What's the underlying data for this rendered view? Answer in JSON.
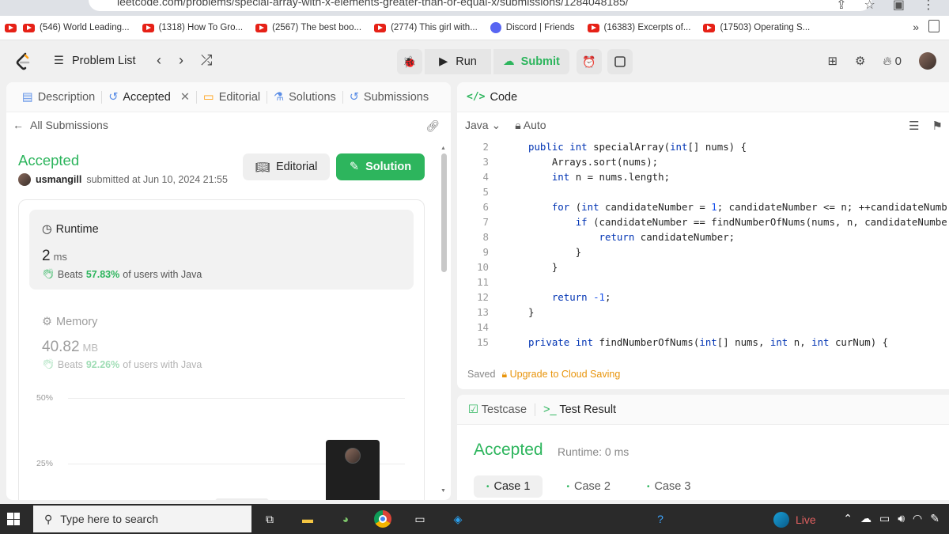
{
  "browser": {
    "url": "leetcode.com/problems/special-array-with-x-elements-greater-than-or-equal-x/submissions/1284048185/",
    "bookmarks": [
      {
        "icon": "youtube-icon",
        "label": "(546) World Leading..."
      },
      {
        "icon": "youtube-icon",
        "label": "(1318) How To Gro..."
      },
      {
        "icon": "youtube-icon",
        "label": "(2567) The best boo..."
      },
      {
        "icon": "youtube-icon",
        "label": "(2774) This girl with..."
      },
      {
        "icon": "discord-icon",
        "label": "Discord | Friends"
      },
      {
        "icon": "youtube-icon",
        "label": "(16383) Excerpts of..."
      },
      {
        "icon": "youtube-icon",
        "label": "(17503) Operating S..."
      }
    ],
    "more_label": "»"
  },
  "nav": {
    "problem_list": "Problem List",
    "run": "Run",
    "submit": "Submit",
    "streak": "0"
  },
  "left": {
    "tabs": [
      "Description",
      "Accepted",
      "Editorial",
      "Solutions",
      "Submissions"
    ],
    "all_submissions": "All Submissions",
    "status": "Accepted",
    "username": "usmangill",
    "submitted_text": "submitted at Jun 10, 2024 21:55",
    "editorial_btn": "Editorial",
    "solution_btn": "Solution",
    "runtime": {
      "label": "Runtime",
      "value": "2",
      "unit": "ms",
      "beats_prefix": "Beats",
      "beats_pct": "57.83%",
      "beats_suffix": "of users with Java"
    },
    "memory": {
      "label": "Memory",
      "value": "40.82",
      "unit": "MB",
      "beats_prefix": "Beats",
      "beats_pct": "92.26%",
      "beats_suffix": "of users with Java"
    }
  },
  "chart_data": {
    "type": "bar",
    "ylim": [
      0,
      60
    ],
    "y_ticks": [
      "50%",
      "25%"
    ],
    "bars": [
      {
        "value": 5,
        "highlight": false
      },
      {
        "value": 12,
        "highlight": false
      },
      {
        "value": 34,
        "highlight": true
      }
    ]
  },
  "code": {
    "title": "Code",
    "language": "Java",
    "mode": "Auto",
    "lines": [
      {
        "n": "2",
        "text": "public int specialArray(int[] nums) {"
      },
      {
        "n": "3",
        "text": "    Arrays.sort(nums);"
      },
      {
        "n": "4",
        "text": "    int n = nums.length;"
      },
      {
        "n": "5",
        "text": ""
      },
      {
        "n": "6",
        "text": "    for (int candidateNumber = 1; candidateNumber <= n; ++candidateNumb"
      },
      {
        "n": "7",
        "text": "        if (candidateNumber == findNumberOfNums(nums, n, candidateNumbe"
      },
      {
        "n": "8",
        "text": "            return candidateNumber;"
      },
      {
        "n": "9",
        "text": "        }"
      },
      {
        "n": "10",
        "text": "    }"
      },
      {
        "n": "11",
        "text": ""
      },
      {
        "n": "12",
        "text": "    return -1;"
      },
      {
        "n": "13",
        "text": "}"
      },
      {
        "n": "14",
        "text": ""
      },
      {
        "n": "15",
        "text": "private int findNumberOfNums(int[] nums, int n, int curNum) {"
      }
    ],
    "saved": "Saved",
    "upgrade": "Upgrade to Cloud Saving"
  },
  "result": {
    "tabs": [
      "Testcase",
      "Test Result"
    ],
    "status": "Accepted",
    "runtime": "Runtime: 0 ms",
    "cases": [
      "Case 1",
      "Case 2",
      "Case 3"
    ]
  },
  "taskbar": {
    "search_placeholder": "Type here to search",
    "live": "Live"
  }
}
